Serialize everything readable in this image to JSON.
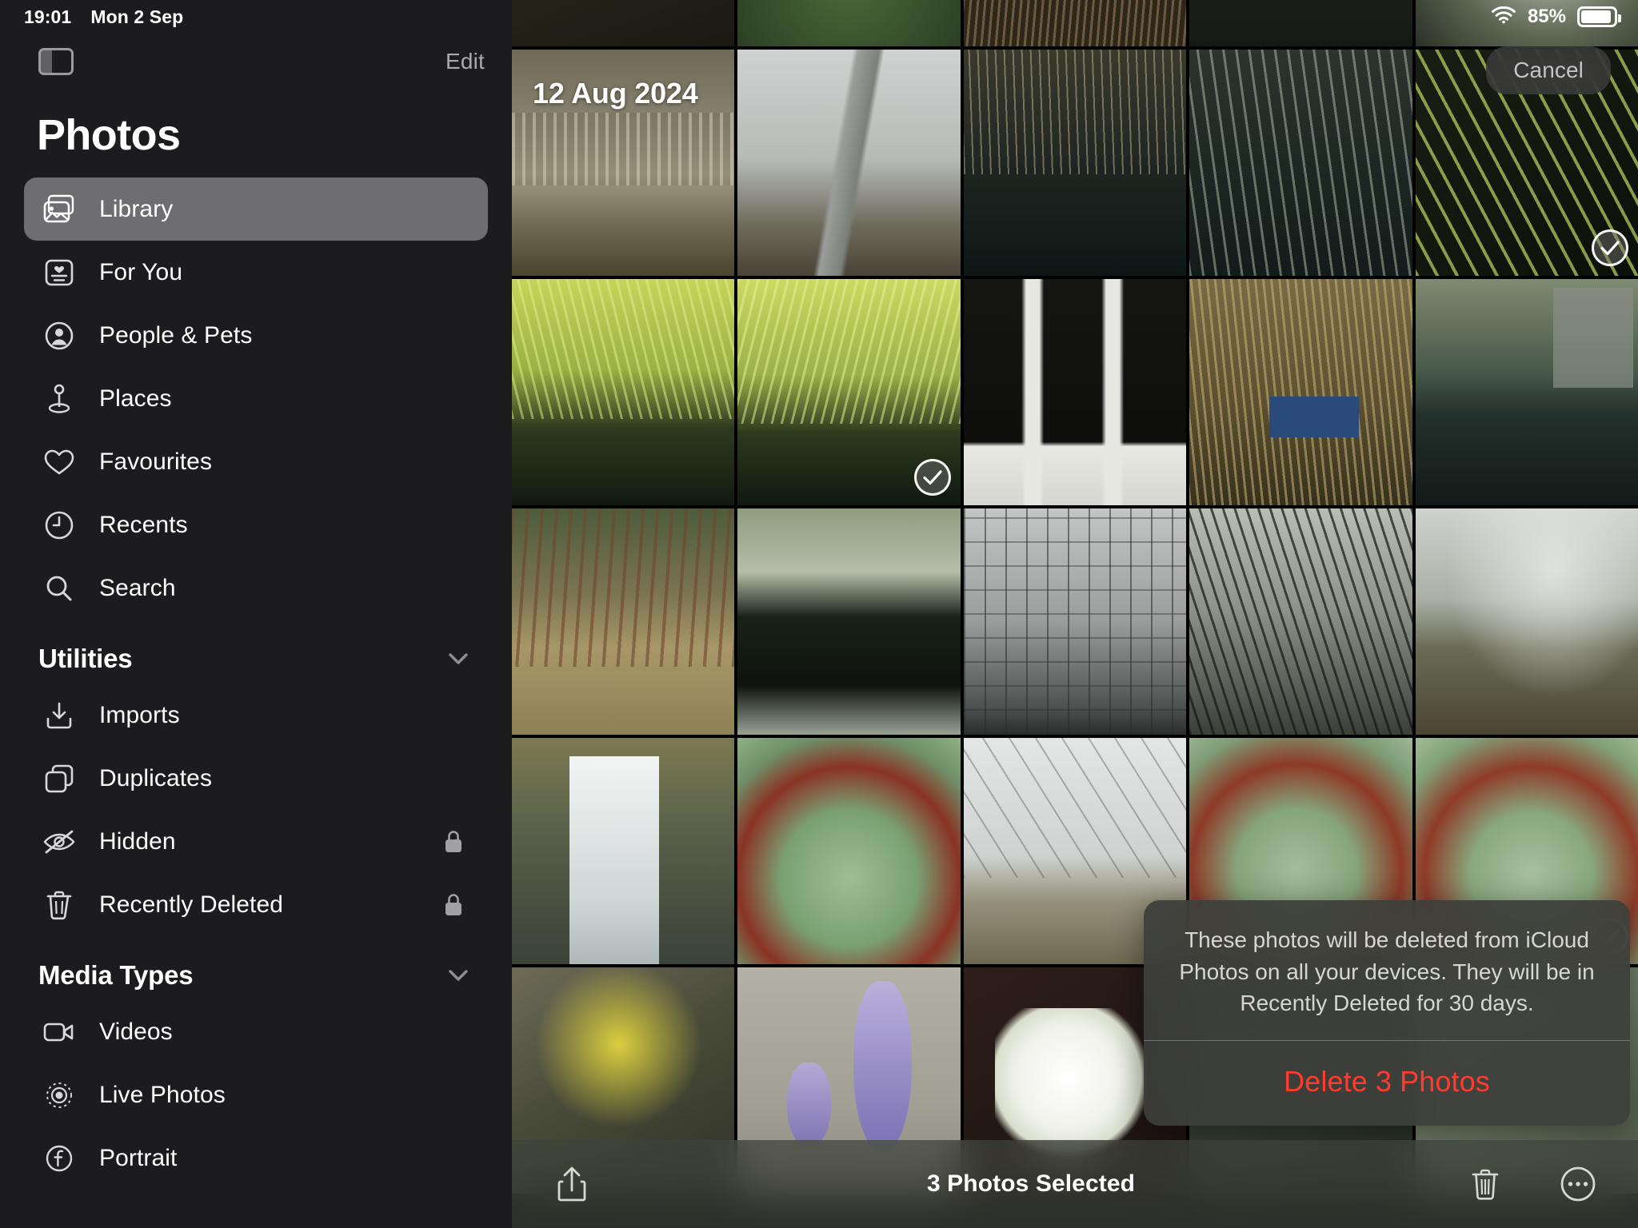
{
  "status_bar": {
    "time": "19:01",
    "date": "Mon 2 Sep",
    "battery_percent": "85%",
    "wifi_icon": "wifi-icon",
    "battery_icon": "battery-icon"
  },
  "sidebar": {
    "panel_toggle_icon": "sidebar-toggle-icon",
    "edit_label": "Edit",
    "title": "Photos",
    "primary_items": [
      {
        "label": "Library",
        "icon": "photo-stack-icon",
        "selected": true,
        "locked": false
      },
      {
        "label": "For You",
        "icon": "for-you-card-icon",
        "selected": false,
        "locked": false
      },
      {
        "label": "People & Pets",
        "icon": "person-circle-icon",
        "selected": false,
        "locked": false
      },
      {
        "label": "Places",
        "icon": "map-pin-icon",
        "selected": false,
        "locked": false
      },
      {
        "label": "Favourites",
        "icon": "heart-icon",
        "selected": false,
        "locked": false
      },
      {
        "label": "Recents",
        "icon": "clock-icon",
        "selected": false,
        "locked": false
      },
      {
        "label": "Search",
        "icon": "search-icon",
        "selected": false,
        "locked": false
      }
    ],
    "utilities": {
      "title": "Utilities",
      "chevron_icon": "chevron-down-icon",
      "items": [
        {
          "label": "Imports",
          "icon": "import-arrow-icon",
          "locked": false
        },
        {
          "label": "Duplicates",
          "icon": "duplicate-squares-icon",
          "locked": false
        },
        {
          "label": "Hidden",
          "icon": "eye-slash-icon",
          "locked": true
        },
        {
          "label": "Recently Deleted",
          "icon": "trash-icon",
          "locked": true
        }
      ]
    },
    "media_types": {
      "title": "Media Types",
      "chevron_icon": "chevron-down-icon",
      "items": [
        {
          "label": "Videos",
          "icon": "video-camera-icon",
          "locked": false
        },
        {
          "label": "Live Photos",
          "icon": "live-photo-icon",
          "locked": false
        },
        {
          "label": "Portrait",
          "icon": "aperture-f-icon",
          "locked": false
        }
      ]
    },
    "lock_icon": "lock-icon"
  },
  "content": {
    "date_header": "12 Aug 2024",
    "cancel_label": "Cancel",
    "columns": 5,
    "selection_check_icon": "checkmark-circle-icon",
    "burst_indicator_icon": "burst-dots-icon",
    "photos": [
      {
        "row": 0,
        "col": 0,
        "desc": "dark-foliage",
        "selected": false
      },
      {
        "row": 0,
        "col": 1,
        "desc": "green-leaves-burst",
        "selected": false,
        "burst": true
      },
      {
        "row": 0,
        "col": 2,
        "desc": "bare-branches",
        "selected": false
      },
      {
        "row": 0,
        "col": 3,
        "desc": "dark-shrub",
        "selected": false
      },
      {
        "row": 0,
        "col": 4,
        "desc": "white-blossom",
        "selected": false
      },
      {
        "row": 1,
        "col": 0,
        "desc": "wooden-bench-garden",
        "selected": false
      },
      {
        "row": 1,
        "col": 1,
        "desc": "glasshouse-pyramid",
        "selected": false
      },
      {
        "row": 1,
        "col": 2,
        "desc": "reeds-reflection-pond",
        "selected": false
      },
      {
        "row": 1,
        "col": 3,
        "desc": "tall-grass-stems",
        "selected": false
      },
      {
        "row": 1,
        "col": 4,
        "desc": "yellow-grass-water",
        "selected": true
      },
      {
        "row": 2,
        "col": 0,
        "desc": "golden-grass-pond",
        "selected": false
      },
      {
        "row": 2,
        "col": 1,
        "desc": "golden-grass-pond-2",
        "selected": true
      },
      {
        "row": 2,
        "col": 2,
        "desc": "glasshouse-door-orchids",
        "selected": false
      },
      {
        "row": 2,
        "col": 3,
        "desc": "reeds-blue-sign",
        "selected": false
      },
      {
        "row": 2,
        "col": 4,
        "desc": "lake-building-reflection",
        "selected": false
      },
      {
        "row": 3,
        "col": 0,
        "desc": "bulrushes-cattails",
        "selected": false
      },
      {
        "row": 3,
        "col": 1,
        "desc": "tree-reflection-lake",
        "selected": false
      },
      {
        "row": 3,
        "col": 2,
        "desc": "glasshouse-dome-grey",
        "selected": false
      },
      {
        "row": 3,
        "col": 3,
        "desc": "tangled-branches",
        "selected": false
      },
      {
        "row": 3,
        "col": 4,
        "desc": "glasshouse-arch-rockery",
        "selected": false
      },
      {
        "row": 4,
        "col": 0,
        "desc": "waterfall-cascade",
        "selected": false
      },
      {
        "row": 4,
        "col": 1,
        "desc": "succulent-rosettes",
        "selected": false
      },
      {
        "row": 4,
        "col": 2,
        "desc": "glasshouse-interior-path",
        "selected": false
      },
      {
        "row": 4,
        "col": 3,
        "desc": "succulent-closeup",
        "selected": false
      },
      {
        "row": 4,
        "col": 4,
        "desc": "succulent-rosettes-2",
        "selected": true
      },
      {
        "row": 5,
        "col": 0,
        "desc": "yellow-flowers",
        "selected": false
      },
      {
        "row": 5,
        "col": 1,
        "desc": "purple-spike-flowers",
        "selected": false
      },
      {
        "row": 5,
        "col": 2,
        "desc": "white-poppy-flower",
        "selected": false
      },
      {
        "row": 5,
        "col": 3,
        "desc": "hidden-behind-dialog",
        "selected": false
      },
      {
        "row": 5,
        "col": 4,
        "desc": "hidden-behind-dialog-2",
        "selected": false
      }
    ]
  },
  "confirm_dialog": {
    "message": "These photos will be deleted from iCloud Photos on all your devices. They will be in Recently Deleted for 30 days.",
    "action_label": "Delete 3 Photos",
    "action_color": "#ff3b30"
  },
  "toolbar": {
    "share_icon": "share-arrow-icon",
    "status_label": "3 Photos Selected",
    "trash_icon": "trash-icon",
    "more_icon": "more-circle-icon"
  }
}
